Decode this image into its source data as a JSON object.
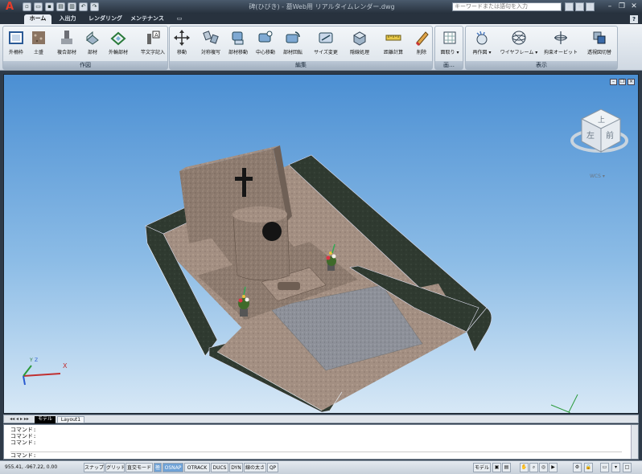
{
  "app": {
    "title": "碑(ひびき) - 墓Web用 リアルタイムレンダー.dwg",
    "search_placeholder": "キーワードまたは語句を入力",
    "logo": "A"
  },
  "quick_access": [
    "new-icon",
    "open-icon",
    "save-icon",
    "saveas-icon",
    "print-icon",
    "undo-icon",
    "redo-icon"
  ],
  "search_icons": [
    "binoculars-icon",
    "star-icon",
    "help-icon"
  ],
  "window_buttons": [
    "–",
    "❐",
    "✕"
  ],
  "tabs": [
    "ホーム",
    "入出力",
    "レンダリング",
    "メンテナンス"
  ],
  "tab_extra": "▭",
  "ribbon": {
    "help": "?",
    "panels": [
      {
        "title": "作図",
        "buttons": [
          "外柵枠",
          "土盛",
          "複合部材",
          "部材",
          "外輪部材",
          "竿文字記入"
        ]
      },
      {
        "title": "編集",
        "buttons": [
          "移動",
          "対称複写",
          "部材移動",
          "中心移動",
          "部材回転",
          "サイズ変更",
          "隠線処理",
          "距離計算",
          "削除"
        ]
      },
      {
        "title": "画…",
        "buttons": [
          "面取り ▾"
        ]
      },
      {
        "title": "表示",
        "buttons": [
          "再作図 ▾",
          "ワイヤフレーム ▾",
          "拘束オービット",
          "透視図切替"
        ]
      }
    ]
  },
  "viewcube": {
    "top": "上",
    "left": "左",
    "front": "前",
    "wcs": "WCS ▾"
  },
  "ucs": {
    "x": "X",
    "y": "Y",
    "z": "Z"
  },
  "layout_tabs": [
    "モデル",
    "Layout1"
  ],
  "command_lines": [
    "コマンド:",
    "コマンド:",
    "コマンド:",
    "コマンド:"
  ],
  "status": {
    "coords": "955.41,   -967.22, 0.00",
    "toggles": [
      {
        "label": "スナップ",
        "on": false
      },
      {
        "label": "グリッド",
        "on": false
      },
      {
        "label": "直交モード",
        "on": false
      },
      {
        "label": "極",
        "on": true
      },
      {
        "label": "OSNAP",
        "on": true
      },
      {
        "label": "OTRACK",
        "on": false
      },
      {
        "label": "DUCS",
        "on": false
      },
      {
        "label": "DYN",
        "on": false
      },
      {
        "label": "線の太さ",
        "on": false
      },
      {
        "label": "QP",
        "on": false
      }
    ],
    "model": "モデル"
  },
  "colors": {
    "granite": "#8c7a6e",
    "black_granite": "#2f3a30",
    "gravel": "#8d9099",
    "sky_top": "#4b8fd3",
    "sky_bottom": "#d7e8f6"
  }
}
